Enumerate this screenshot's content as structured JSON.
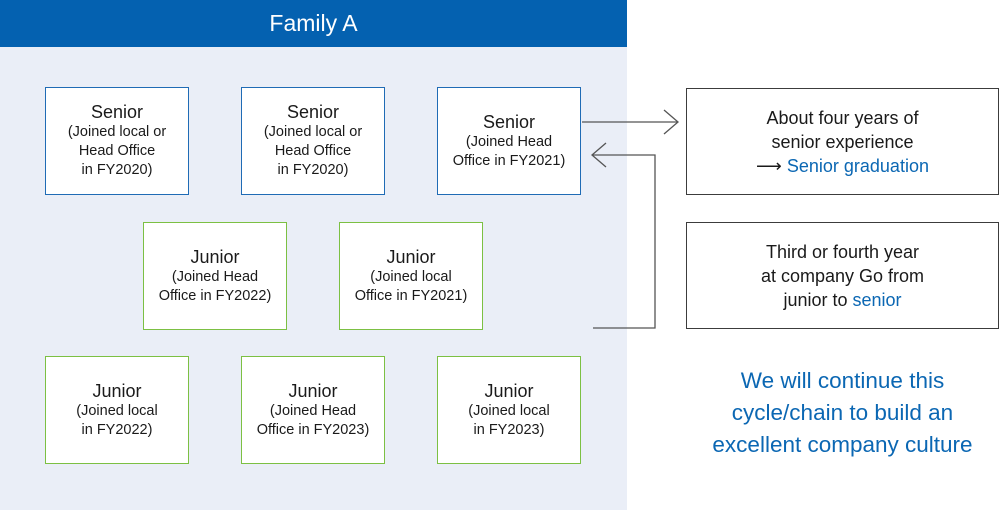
{
  "panel": {
    "title": "Family A"
  },
  "members": [
    {
      "role": "Senior",
      "detail": "(Joined local or\nHead Office\nin FY2020)",
      "type": "senior"
    },
    {
      "role": "Senior",
      "detail": "(Joined local or\nHead Office\nin FY2020)",
      "type": "senior"
    },
    {
      "role": "Senior",
      "detail": "(Joined Head\nOffice in FY2021)",
      "type": "senior"
    },
    {
      "role": "Junior",
      "detail": "(Joined Head\nOffice in FY2022)",
      "type": "junior"
    },
    {
      "role": "Junior",
      "detail": "(Joined local\nOffice in FY2021)",
      "type": "junior"
    },
    {
      "role": "Junior",
      "detail": "(Joined local\nin FY2022)",
      "type": "junior"
    },
    {
      "role": "Junior",
      "detail": "(Joined Head\nOffice in FY2023)",
      "type": "junior"
    },
    {
      "role": "Junior",
      "detail": "(Joined local\nin FY2023)",
      "type": "junior"
    }
  ],
  "graduation_box": {
    "line1": "About four years of",
    "line2": "senior experience",
    "arrow_glyph": "⟶",
    "highlight": "Senior graduation"
  },
  "promotion_box": {
    "line1": "Third or fourth year",
    "line2": "at company Go from",
    "line3_prefix": "junior to ",
    "highlight": "senior"
  },
  "closing_message": "We will continue this\ncycle/chain to build an\nexcellent company culture",
  "colors": {
    "header_blue": "#0461b0",
    "senior_border": "#1f6bb5",
    "junior_border": "#7cc043",
    "accent_text": "#0b67b3",
    "panel_bg": "#eaeef7"
  }
}
